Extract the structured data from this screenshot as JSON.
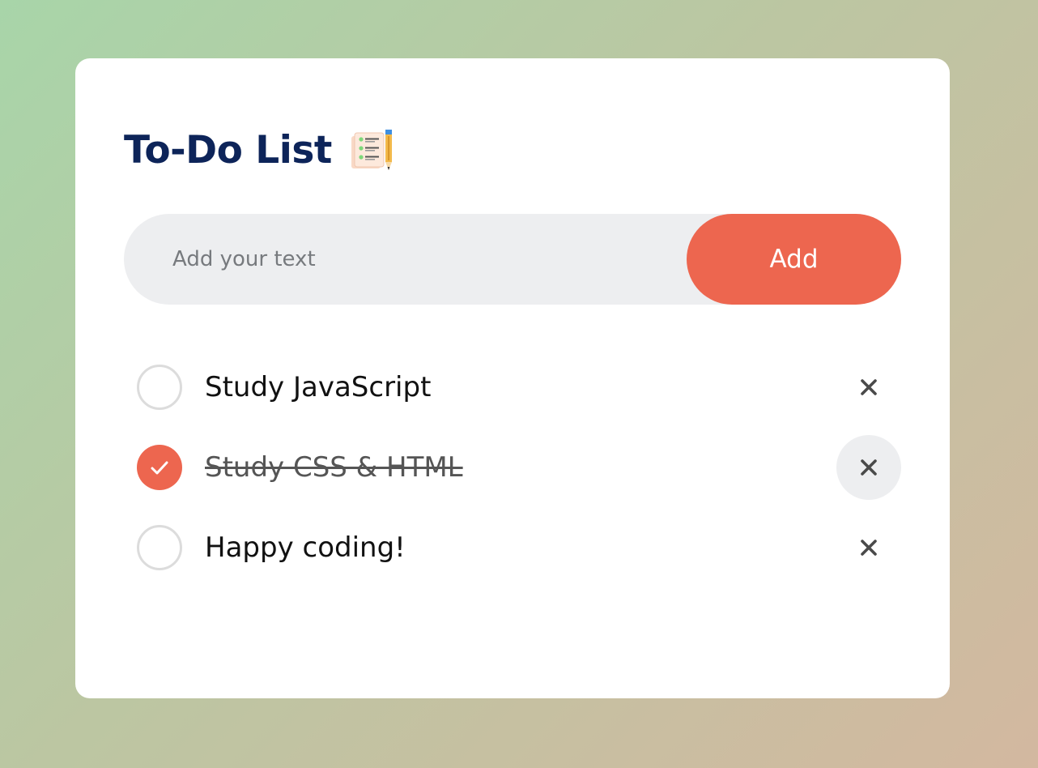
{
  "app": {
    "title": "To-Do List",
    "title_icon": "notepad-pencil-icon"
  },
  "input": {
    "value": "",
    "placeholder": "Add your text"
  },
  "add_button": {
    "label": "Add"
  },
  "tasks": [
    {
      "text": "Study JavaScript",
      "checked": false
    },
    {
      "text": "Study CSS & HTML",
      "checked": true
    },
    {
      "text": "Happy coding!",
      "checked": false
    }
  ],
  "colors": {
    "accent": "#ed664f",
    "title": "#0d2459",
    "input_bg": "#edeef0",
    "card_bg": "#ffffff"
  },
  "icons": {
    "delete": "close-icon",
    "check": "checkmark-icon",
    "unchecked": "empty-circle-icon"
  }
}
